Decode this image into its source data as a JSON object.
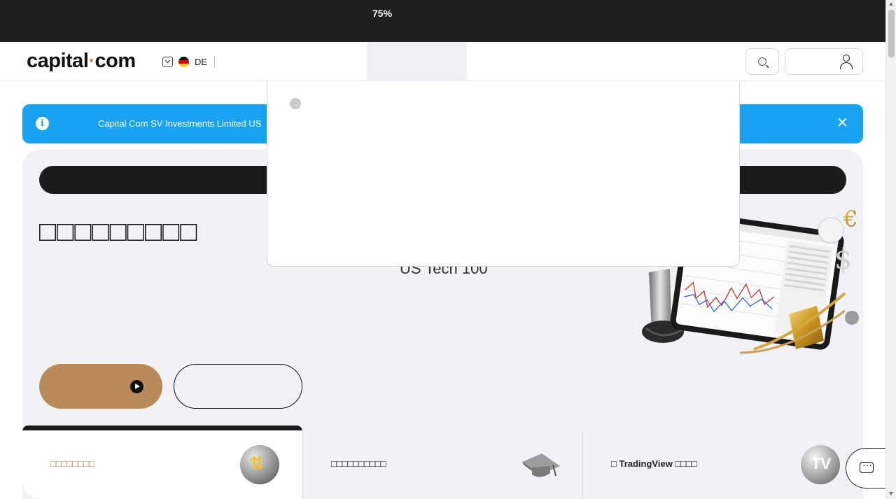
{
  "topbar": {
    "zoom_level": "75%"
  },
  "header": {
    "logo_text_a": "capital",
    "logo_dot": "·",
    "logo_text_b": "com",
    "language": {
      "code": "DE",
      "flag": "germany-flag-icon"
    },
    "search_icon": "search-icon",
    "account_icon": "user-icon"
  },
  "banner": {
    "text": "Capital Com SV Investments Limited    US",
    "info_icon": "i",
    "close_icon": "✕"
  },
  "hero": {
    "title": "□□□□□□□□□",
    "instrument_label": "US Tech 100"
  },
  "cards": [
    {
      "label": "□□□□□□□□",
      "icon": "arrows-up-down-icon",
      "icon_glyph": "⇅"
    },
    {
      "label": "□□□□□□□□□□",
      "icon": "graduation-cap-icon",
      "icon_glyph": "🎓"
    },
    {
      "label_prefix": "□ ",
      "label_bold": "TradingView",
      "label_suffix": " □□□□",
      "icon": "tradingview-icon",
      "icon_glyph": "TV"
    }
  ],
  "dropdown": {
    "arrow_icon": "→"
  },
  "colors": {
    "accent": "#b88a5a",
    "banner": "#17a3f2",
    "dark": "#1b1b1b",
    "hero_bg": "#f0f2f5"
  }
}
